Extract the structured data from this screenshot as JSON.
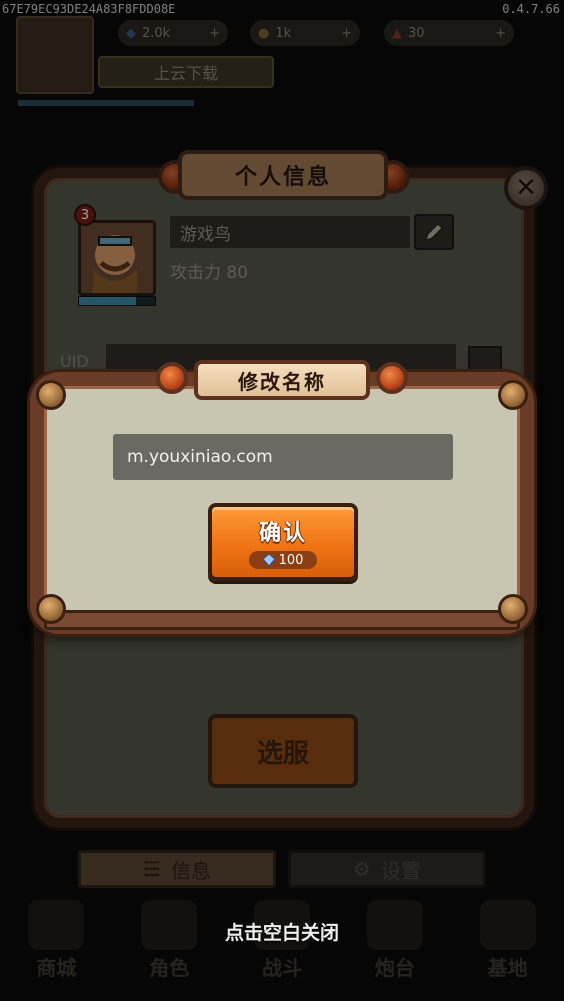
{
  "debug": {
    "device_id": "67E79EC93DE24A83F8FDD08E",
    "version": "0.4.7.66"
  },
  "hud": {
    "download_label": "上云下载",
    "gem_amount": "2.0k",
    "coin_amount": "1k",
    "ticket_amount": "30"
  },
  "profile_panel": {
    "title": "个人信息",
    "level": "3",
    "player_name": "游戏鸟",
    "attack_text": "攻击力 80",
    "uid_label": "UID",
    "exp_progress": 0.75,
    "server_button": "选服",
    "tabs": [
      {
        "label": "信息"
      },
      {
        "label": "设置"
      }
    ]
  },
  "bottom_nav": [
    {
      "label": "商城",
      "icon": "shop-icon"
    },
    {
      "label": "角色",
      "icon": "character-icon"
    },
    {
      "label": "战斗",
      "icon": "battle-icon"
    },
    {
      "label": "炮台",
      "icon": "turret-icon"
    },
    {
      "label": "基地",
      "icon": "base-icon"
    }
  ],
  "rename_dialog": {
    "title": "修改名称",
    "input_value": "m.youxiniao.com",
    "confirm_label": "确认",
    "cost": "100",
    "cost_icon": "diamond-icon"
  },
  "tap_to_close": "点击空白关闭",
  "colors": {
    "confirm_orange": "#f07414",
    "frame_brown": "#6a3c27",
    "dialog_bg": "#c8c5b1"
  }
}
